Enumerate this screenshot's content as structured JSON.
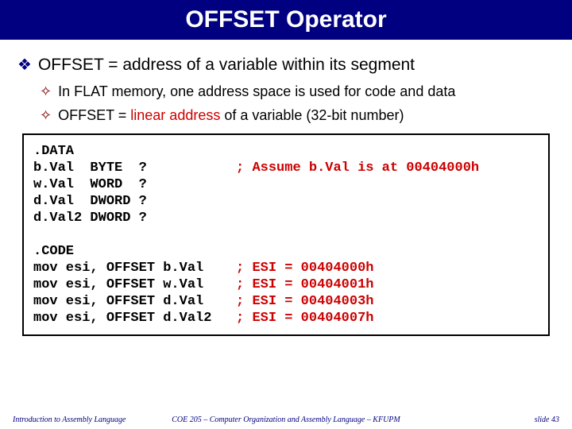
{
  "title": "OFFSET Operator",
  "bullets": {
    "b1": "OFFSET = address of a variable within its segment",
    "b2a": "In FLAT memory, one address space is used for code and data",
    "b2b_pre": "OFFSET = ",
    "b2b_hl": "linear address",
    "b2b_post": " of a variable (32-bit number)"
  },
  "code": {
    "l01": ".DATA",
    "l02_a": "b.Val  BYTE  ?           ",
    "l02_b": "; Assume b.Val is at 00404000h",
    "l03": "w.Val  WORD  ?",
    "l04": "d.Val  DWORD ?",
    "l05": "d.Val2 DWORD ?",
    "gap": " ",
    "l06": ".CODE",
    "l07_a": "mov esi, OFFSET b.Val    ",
    "l07_b": "; ESI = 00404000h",
    "l08_a": "mov esi, OFFSET w.Val    ",
    "l08_b": "; ESI = 00404001h",
    "l09_a": "mov esi, OFFSET d.Val    ",
    "l09_b": "; ESI = 00404003h",
    "l10_a": "mov esi, OFFSET d.Val2   ",
    "l10_b": "; ESI = 00404007h"
  },
  "footer": {
    "left": "Introduction to Assembly Language",
    "center": "COE 205 – Computer Organization and Assembly Language – KFUPM",
    "right": "slide 43"
  }
}
